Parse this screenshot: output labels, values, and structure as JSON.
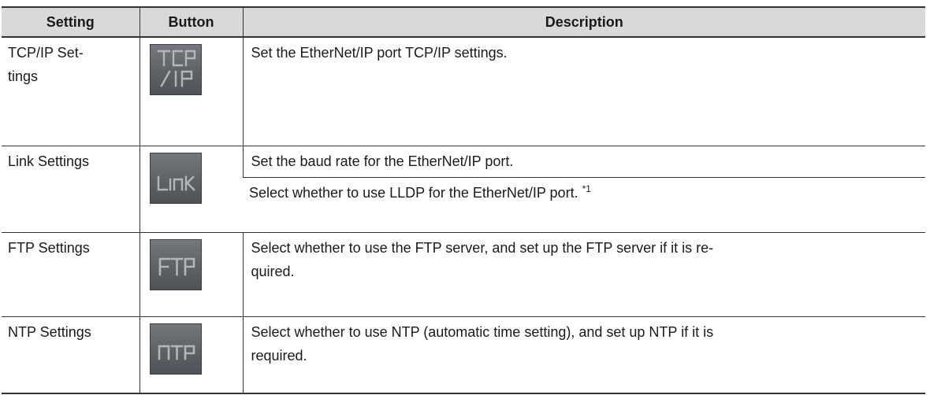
{
  "headers": {
    "setting": "Setting",
    "button": "Button",
    "description": "Description"
  },
  "rows": [
    {
      "setting": "TCP/IP Settings",
      "setting_display": [
        "TCP/IP Set-",
        "tings"
      ],
      "button_icon": "tcp-ip-button-icon",
      "button_text": "TCP/IP",
      "descriptions": [
        "Set the EtherNet/IP port TCP/IP settings."
      ]
    },
    {
      "setting": "Link Settings",
      "button_icon": "link-button-icon",
      "button_text": "LINK",
      "descriptions": [
        "Set the baud rate for the EtherNet/IP port.",
        "Select whether to use LLDP for the EtherNet/IP port."
      ],
      "footnote": "*1"
    },
    {
      "setting": "FTP Settings",
      "button_icon": "ftp-button-icon",
      "button_text": "FTP",
      "descriptions": [
        "Select whether to use the FTP server, and set up the FTP server if it is re- quired."
      ],
      "description_display": [
        "Select whether to use the FTP server, and set up the FTP server if it is re-",
        "quired."
      ]
    },
    {
      "setting": "NTP Settings",
      "button_icon": "ntp-button-icon",
      "button_text": "NTP",
      "descriptions": [
        "Select whether to use NTP (automatic time setting), and set up NTP if it is required."
      ],
      "description_display": [
        "Select whether to use NTP (automatic time setting), and set up NTP if it is",
        "required."
      ]
    }
  ],
  "colors": {
    "header_bg": "#d9d9d9",
    "button_bg": "#5e6267",
    "button_glyph": "#b3b6ba"
  }
}
